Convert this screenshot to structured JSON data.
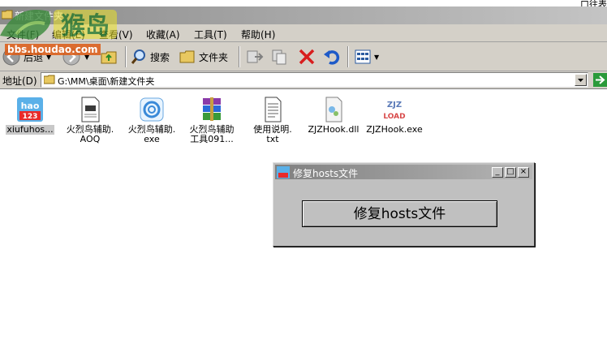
{
  "background_window": {
    "partial_text": "口往表首"
  },
  "window": {
    "title": "新建文件夹"
  },
  "watermark": {
    "site": "猴岛",
    "url": "bbs.houdao.com"
  },
  "menu": {
    "items": [
      {
        "label": "文件(F)"
      },
      {
        "label": "编辑(E)"
      },
      {
        "label": "查看(V)"
      },
      {
        "label": "收藏(A)"
      },
      {
        "label": "工具(T)"
      },
      {
        "label": "帮助(H)"
      }
    ]
  },
  "toolbar": {
    "back_label": "后退",
    "search_label": "搜索",
    "folders_label": "文件夹"
  },
  "address": {
    "label": "地址(D)",
    "path": "G:\\MM\\桌面\\新建文件夹"
  },
  "files": [
    {
      "name": "xiufuhos...",
      "icon": "hao123-icon",
      "selected": true
    },
    {
      "name": "火烈鸟辅助.\nAOQ",
      "icon": "document-icon",
      "selected": false
    },
    {
      "name": "火烈鸟辅助.\nexe",
      "icon": "swirl-app-icon",
      "selected": false
    },
    {
      "name": "火烈鸟辅助\n工具091...",
      "icon": "winrar-archive-icon",
      "selected": false
    },
    {
      "name": "使用说明.\ntxt",
      "icon": "text-file-icon",
      "selected": false
    },
    {
      "name": "ZJZHook.dll",
      "icon": "dll-file-icon",
      "selected": false
    },
    {
      "name": "ZJZHook.exe",
      "icon": "zjz-load-icon",
      "selected": false
    }
  ],
  "zjz_icon_text": {
    "top": "ZJZ",
    "bottom": "LOAD"
  },
  "hao_icon_text": {
    "top": "hao",
    "bottom": "123"
  },
  "dialog": {
    "title": "修复hosts文件",
    "button_label": "修复hosts文件",
    "min_symbol": "_",
    "max_symbol": "□",
    "close_symbol": "×"
  },
  "colors": {
    "titlebar_start": "#8c8c8c",
    "chrome": "#d4d0c8",
    "dialog_face": "#c0c0c0",
    "close_red": "#d81e1e",
    "undo_blue": "#1e5ac8"
  }
}
